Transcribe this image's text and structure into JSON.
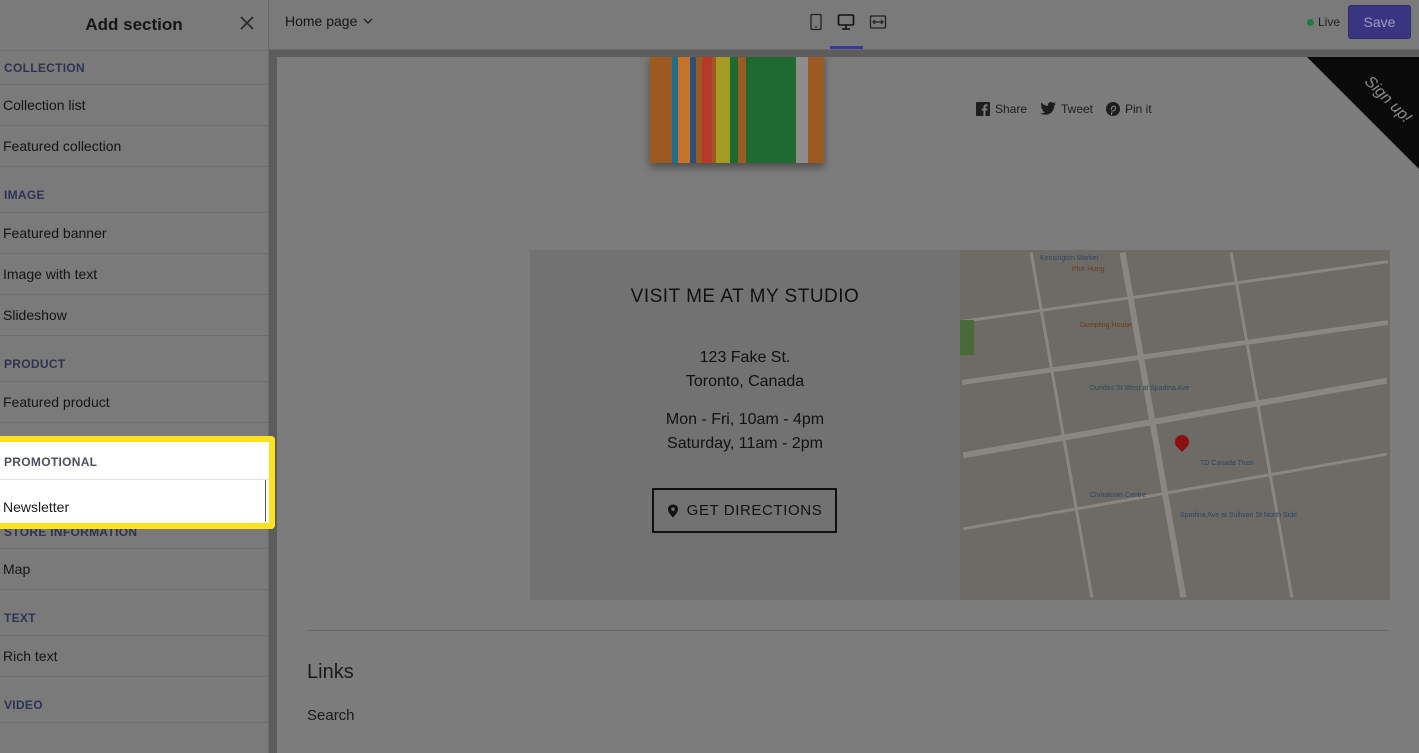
{
  "sidebar": {
    "title": "Add section",
    "categories": [
      {
        "label": "COLLECTION",
        "items": [
          "Collection list",
          "Featured collection"
        ]
      },
      {
        "label": "IMAGE",
        "items": [
          "Featured banner",
          "Image with text",
          "Slideshow"
        ]
      },
      {
        "label": "PRODUCT",
        "items": [
          "Featured product"
        ]
      },
      {
        "label": "PROMOTIONAL",
        "items": [
          "Newsletter"
        ]
      },
      {
        "label": "STORE INFORMATION",
        "items": [
          "Map"
        ]
      },
      {
        "label": "TEXT",
        "items": [
          "Rich text"
        ]
      },
      {
        "label": "VIDEO",
        "items": []
      }
    ]
  },
  "topbar": {
    "page_select": "Home page",
    "status": "Live",
    "save_label": "Save",
    "accent": "#3a3580",
    "live_color": "#1f7a3c"
  },
  "preview": {
    "social": {
      "share": "Share",
      "tweet": "Tweet",
      "pin": "Pin it"
    },
    "ribbon_text": "Sign up!",
    "store": {
      "title": "VISIT ME AT MY STUDIO",
      "address_line1": "123 Fake St.",
      "address_line2": "Toronto, Canada",
      "hours_line1": "Mon - Fri, 10am - 4pm",
      "hours_line2": "Saturday, 11am - 2pm",
      "directions_label": "GET DIRECTIONS"
    },
    "map_labels": [
      "Kensington Market",
      "Phở Hưng",
      "Dumpling House",
      "Dundas St West at Spadina Ave",
      "TD Canada Trust",
      "Chinatown Centre",
      "Spadina Ave at Sullivan St North Side"
    ],
    "links_title": "Links",
    "links": [
      "Search"
    ]
  },
  "highlight_color": "#ffe21c"
}
